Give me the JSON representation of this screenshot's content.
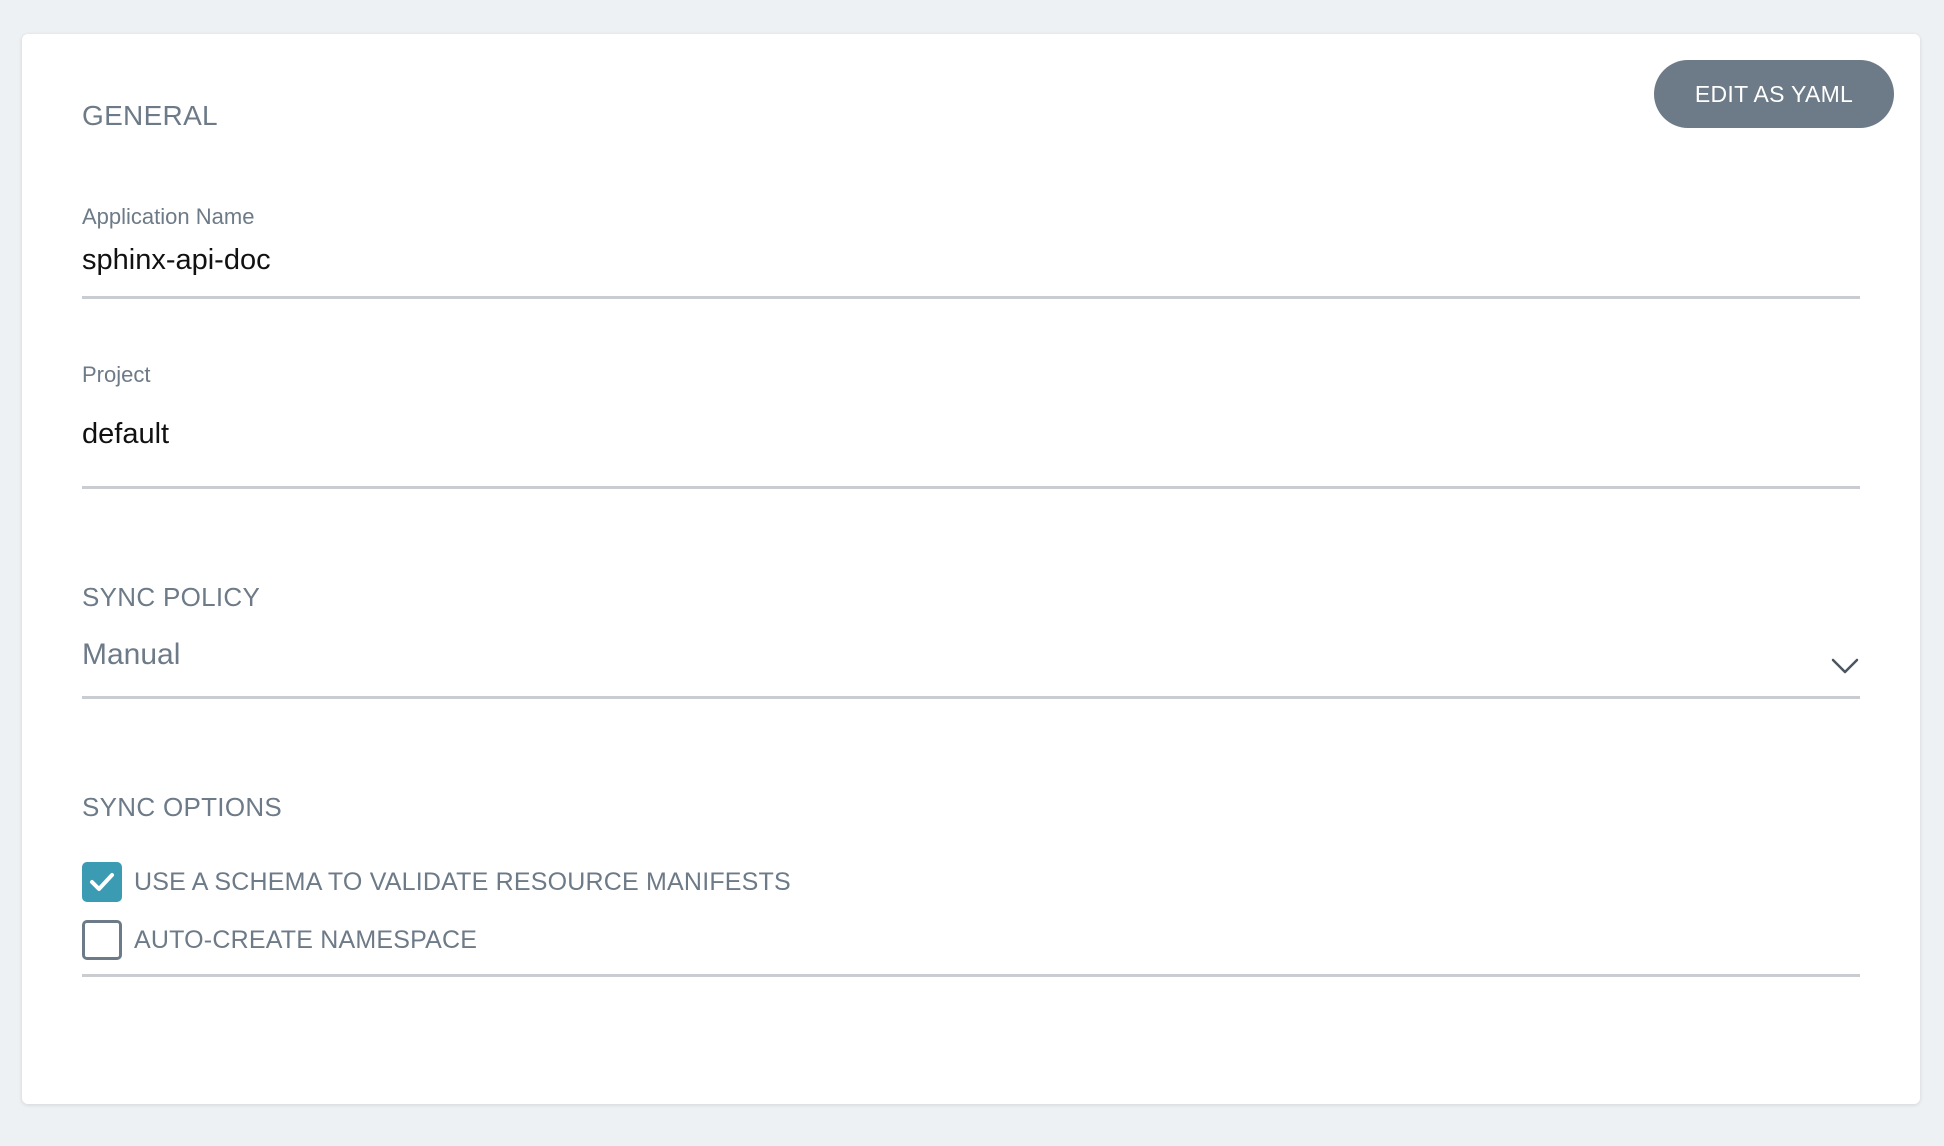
{
  "toolbar": {
    "edit_yaml_label": "EDIT AS YAML"
  },
  "general": {
    "section_title": "GENERAL",
    "application_name": {
      "label": "Application Name",
      "value": "sphinx-api-doc"
    },
    "project": {
      "label": "Project",
      "value": "default"
    }
  },
  "sync_policy": {
    "section_title": "SYNC POLICY",
    "selected": "Manual",
    "icon": "chevron-down-icon"
  },
  "sync_options": {
    "section_title": "SYNC OPTIONS",
    "items": [
      {
        "label": "USE A SCHEMA TO VALIDATE RESOURCE MANIFESTS",
        "checked": true
      },
      {
        "label": "AUTO-CREATE NAMESPACE",
        "checked": false
      }
    ]
  },
  "colors": {
    "background": "#eef1f4",
    "button": "#6d7a87",
    "checkbox_checked": "#3b9bb3",
    "label_text": "#6d7a87",
    "underline": "#c9ccd0"
  }
}
